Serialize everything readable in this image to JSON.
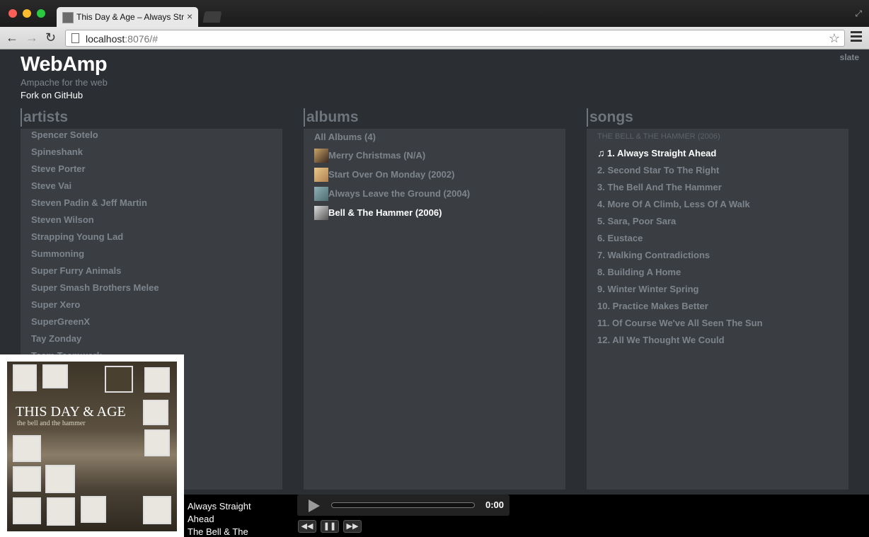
{
  "browser": {
    "tab_title": "This Day & Age – Always Straight Ahead",
    "tab_close": "×",
    "url_host": "localhost",
    "url_rest": ":8076/#"
  },
  "app": {
    "logo": "WebAmp",
    "tagline": "Ampache for the web",
    "fork_link": "Fork on GitHub",
    "theme_link": "slate"
  },
  "columns": {
    "artists_title": "artists",
    "albums_title": "albums",
    "songs_title": "songs"
  },
  "artists": [
    "Spencer Sotelo",
    "Spineshank",
    "Steve Porter",
    "Steve Vai",
    "Steven Padin & Jeff Martin",
    "Steven Wilson",
    "Strapping Young Lad",
    "Summoning",
    "Super Furry Animals",
    "Super Smash Brothers Melee",
    "Super Xero",
    "SuperGreenX",
    "Tay Zonday",
    "Team Teamwork"
  ],
  "albums": {
    "all": "All Albums (4)",
    "items": [
      {
        "label": "Merry Christmas (N/A)",
        "active": false
      },
      {
        "label": "Start Over On Monday (2002)",
        "active": false
      },
      {
        "label": "Always Leave the Ground (2004)",
        "active": false
      },
      {
        "label": "Bell & The Hammer (2006)",
        "active": true
      }
    ]
  },
  "songs": {
    "album_heading": "THE BELL & THE HAMMER",
    "album_year": "(2006)",
    "items": [
      "1. Always Straight Ahead",
      "2. Second Star To The Right",
      "3. The Bell And The Hammer",
      "4. More Of A Climb, Less Of A Walk",
      "5. Sara, Poor Sara",
      "6. Eustace",
      "7. Walking Contradictions",
      "8. Building A Home",
      "9. Winter Winter Spring",
      "10. Practice Makes Better",
      "11. Of Course We've All Seen The Sun",
      "12. All We Thought We Could"
    ],
    "playing_index": 0
  },
  "player": {
    "title": "Always Straight Ahead",
    "album": "The Bell & The Hammer",
    "time": "0:00",
    "progress": 0,
    "art_title": "THIS DAY & AGE",
    "art_subtitle": "the bell and the hammer"
  }
}
